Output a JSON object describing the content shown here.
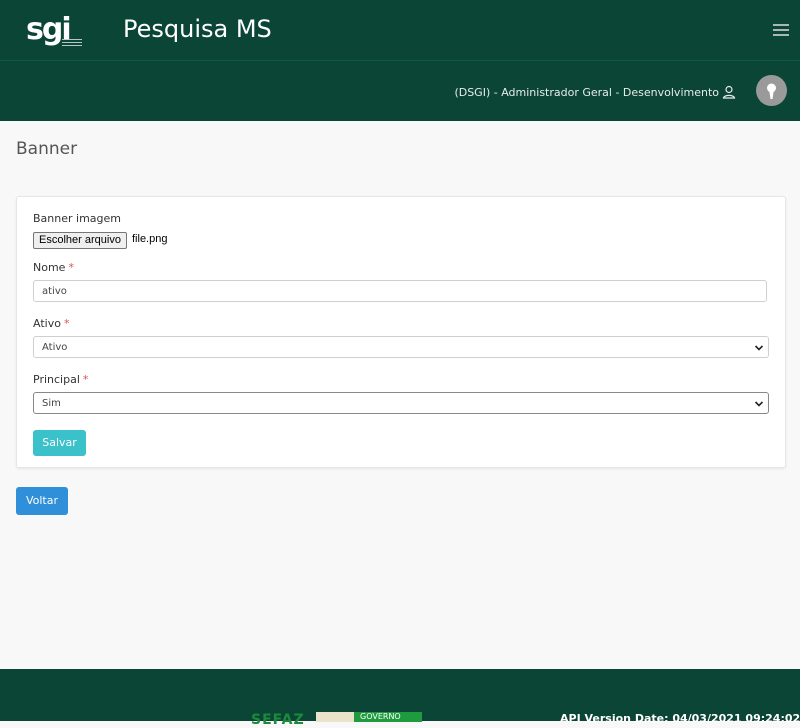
{
  "header": {
    "logo_text": "sgi",
    "app_title": "Pesquisa MS"
  },
  "userbar": {
    "user_text": "(DSGI) - Administrador Geral - Desenvolvimento"
  },
  "page": {
    "title": "Banner"
  },
  "form": {
    "banner_image": {
      "label": "Banner imagem",
      "button_label": "Escolher arquivo",
      "file_name": "file.png"
    },
    "nome": {
      "label": "Nome",
      "required_mark": "*",
      "value": "ativo"
    },
    "ativo": {
      "label": "Ativo",
      "required_mark": "*",
      "selected": "Ativo"
    },
    "principal": {
      "label": "Principal",
      "required_mark": "*",
      "selected": "Sim"
    },
    "save_label": "Salvar"
  },
  "back_label": "Voltar",
  "footer": {
    "sefaz": "SEFAZ",
    "gov_label": "GOVERNO",
    "api_version": "API Version Date: 04/03/2021 09:24:02"
  },
  "colors": {
    "header_bg": "#0b4535",
    "save_button": "#3bc1c9",
    "back_button": "#2f8fd8",
    "required": "#d9534f"
  },
  "icons": {
    "menu": "hamburger-icon",
    "user": "user-icon",
    "avatar": "avatar",
    "select_caret": "chevron-down-icon"
  }
}
